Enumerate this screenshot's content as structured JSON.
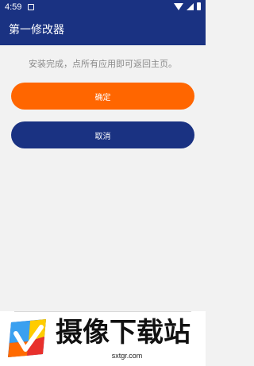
{
  "status_bar": {
    "time": "4:59"
  },
  "app_bar": {
    "title": "第一修改器"
  },
  "main": {
    "message": "安装完成，点所有应用即可返回主页。",
    "confirm_label": "确定",
    "cancel_label": "取消"
  },
  "banner": {
    "title": "摄像下载站",
    "url": "sxtgr.com"
  },
  "colors": {
    "primary": "#1a3282",
    "accent": "#ff6600",
    "background": "#f2f2f2"
  },
  "icons": {
    "notification": "notification-icon",
    "wifi": "wifi-icon",
    "signal": "signal-icon",
    "battery": "battery-icon",
    "logo": "download-site-logo"
  }
}
